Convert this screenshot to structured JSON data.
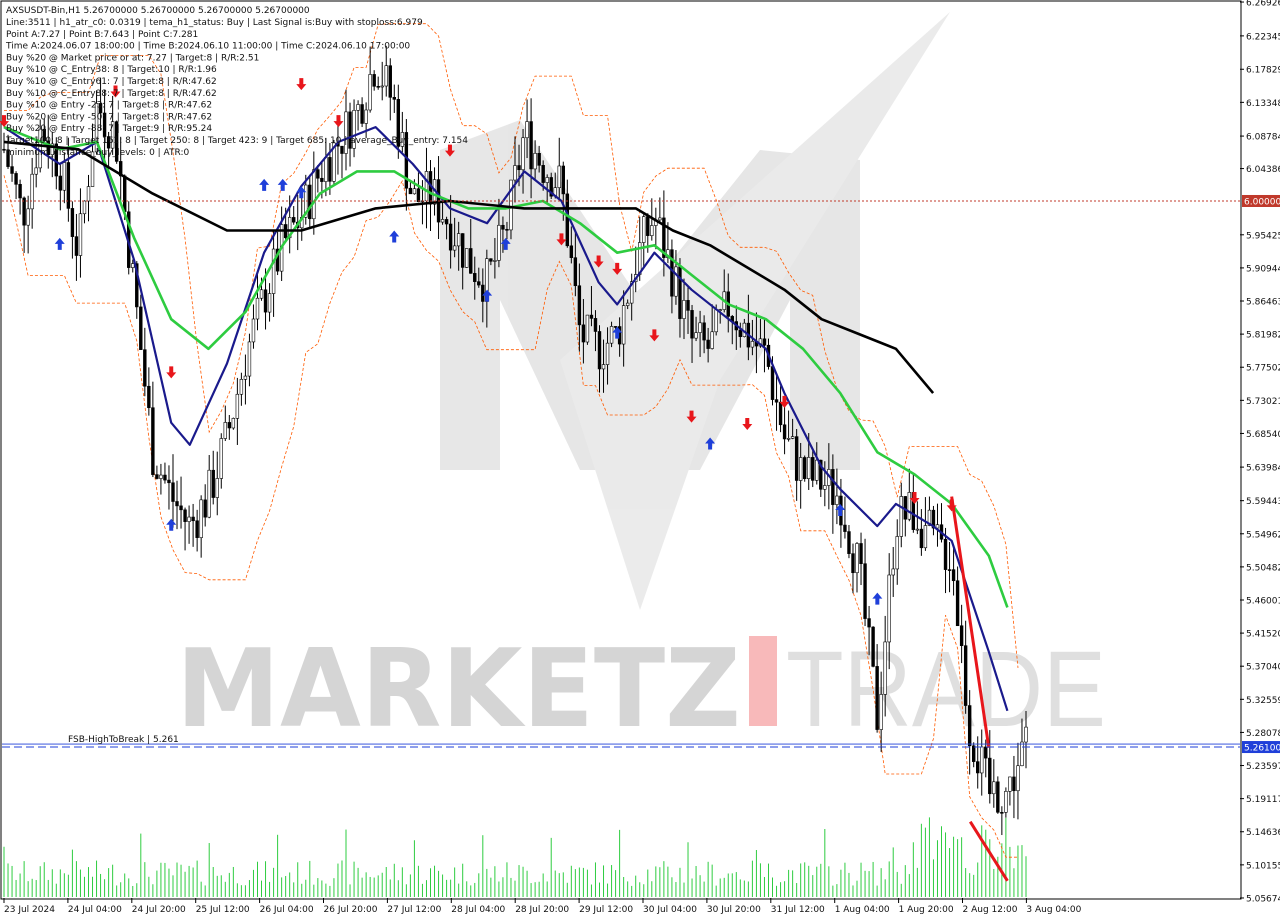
{
  "window": {
    "symbol_line": "AXSUSDT-Bin,H1  5.26700000 5.26700000 5.26700000 5.26700000"
  },
  "info_lines": [
    "Line:3511 | h1_atr_c0: 0.0319 | tema_h1_status: Buy | Last Signal is:Buy with stoploss:6.979",
    "Point A:7.27 | Point B:7.643 | Point C:7.281",
    "Time A:2024.06.07 18:00:00 | Time B:2024.06.10 11:00:00 | Time C:2024.06.10 17:00:00",
    "Buy %20 @ Market price or at: 7.27 | Target:8 | R/R:2.51",
    "Buy %10 @ C_Entry38: 8 | Target:10 | R/R:1.96",
    "Buy %10 @ C_Entry61: 7 | Target:8 | R/R:47.62",
    "Buy %10 @ C_Entry88: 7 | Target:8 | R/R:47.62",
    "Buy %10 @ Entry -23: 7 | Target:8 | R/R:47.62",
    "Buy %20 @ Entry -50: 7 | Target:8 | R/R:47.62",
    "Buy %20 @ Entry -88: 7 | Target:9 | R/R:95.24",
    "Target100: 8 | Target 161: 8 | Target 250: 8 | Target 423: 9 | Target 685: 10 | average_Buy_entry: 7.154",
    "minimum_distance_buy_levels: 0 | ATR:0"
  ],
  "watermark": {
    "brand_left": "MARKETZ",
    "brand_right": "TRADE"
  },
  "price_axis": {
    "ticks": [
      "6.26926",
      "6.22345",
      "6.17829",
      "6.13348",
      "6.08784",
      "6.04386",
      "6.00000",
      "5.95425",
      "5.90944",
      "5.86463",
      "5.81982",
      "5.77502",
      "5.73021",
      "5.68540",
      "5.63984",
      "5.59443",
      "5.54962",
      "5.50482",
      "5.46001",
      "5.41520",
      "5.37040",
      "5.32559",
      "5.28078",
      "5.26100",
      "5.23597",
      "5.19117",
      "5.14636",
      "5.10155",
      "5.05674"
    ],
    "highlighted": [
      {
        "label": "6.00000",
        "price": 6.0,
        "color": "#c0392b"
      },
      {
        "label": "5.26100",
        "price": 5.261,
        "color": "#1f3fd9"
      }
    ]
  },
  "time_axis": {
    "labels": [
      "23 Jul 2024",
      "24 Jul 04:00",
      "24 Jul 20:00",
      "25 Jul 12:00",
      "26 Jul 04:00",
      "26 Jul 20:00",
      "27 Jul 12:00",
      "28 Jul 04:00",
      "28 Jul 20:00",
      "29 Jul 12:00",
      "30 Jul 04:00",
      "30 Jul 20:00",
      "31 Jul 12:00",
      "1 Aug 04:00",
      "1 Aug 20:00",
      "2 Aug 12:00",
      "3 Aug 04:00"
    ]
  },
  "annotations": {
    "fsb_label": "FSB-HighToBreak | 5.261"
  },
  "colors": {
    "candle": "#000000",
    "volume": "#2ecc40",
    "tema_fast": "#1a1a8c",
    "ema_green": "#2ecc40",
    "sma_black": "#000000",
    "channel_orange": "#ff5a00",
    "buy_arrow": "#1f3fd9",
    "sell_arrow": "#e8161b",
    "trend_red": "#e8161b",
    "level_red": "#c0392b",
    "level_blue": "#1f3fd9"
  },
  "chart_data": {
    "type": "candlestick",
    "symbol": "AXSUSDT-Bin",
    "timeframe": "H1",
    "ylim": [
      5.0567,
      6.2693
    ],
    "x_labels": [
      "23 Jul 2024",
      "24 Jul 04:00",
      "24 Jul 20:00",
      "25 Jul 12:00",
      "26 Jul 04:00",
      "26 Jul 20:00",
      "27 Jul 12:00",
      "28 Jul 04:00",
      "28 Jul 20:00",
      "29 Jul 12:00",
      "30 Jul 04:00",
      "30 Jul 20:00",
      "31 Jul 12:00",
      "1 Aug 04:00",
      "1 Aug 20:00",
      "2 Aug 12:00",
      "3 Aug 04:00"
    ],
    "close_path": [
      [
        0,
        6.07
      ],
      [
        1,
        5.98
      ],
      [
        2,
        6.1
      ],
      [
        3,
        6.05
      ],
      [
        4,
        5.93
      ],
      [
        5,
        6.13
      ],
      [
        6,
        6.09
      ],
      [
        7,
        5.88
      ],
      [
        8,
        5.66
      ],
      [
        9,
        5.6
      ],
      [
        10,
        5.56
      ],
      [
        11,
        5.6
      ],
      [
        12,
        5.68
      ],
      [
        13,
        5.79
      ],
      [
        14,
        5.87
      ],
      [
        15,
        5.94
      ],
      [
        16,
        5.98
      ],
      [
        17,
        6.04
      ],
      [
        18,
        6.08
      ],
      [
        19,
        6.12
      ],
      [
        20,
        6.19
      ],
      [
        21,
        6.13
      ],
      [
        22,
        6.0
      ],
      [
        23,
        6.01
      ],
      [
        24,
        5.97
      ],
      [
        25,
        5.92
      ],
      [
        26,
        5.89
      ],
      [
        27,
        5.96
      ],
      [
        28,
        6.09
      ],
      [
        29,
        6.05
      ],
      [
        30,
        6.02
      ],
      [
        31,
        5.82
      ],
      [
        32,
        5.8
      ],
      [
        33,
        5.82
      ],
      [
        34,
        5.92
      ],
      [
        35,
        5.98
      ],
      [
        36,
        5.9
      ],
      [
        37,
        5.81
      ],
      [
        38,
        5.8
      ],
      [
        39,
        5.86
      ],
      [
        40,
        5.82
      ],
      [
        41,
        5.79
      ],
      [
        42,
        5.68
      ],
      [
        43,
        5.63
      ],
      [
        44,
        5.62
      ],
      [
        45,
        5.6
      ],
      [
        46,
        5.5
      ],
      [
        47,
        5.3
      ],
      [
        48,
        5.57
      ],
      [
        49,
        5.58
      ],
      [
        50,
        5.54
      ],
      [
        51,
        5.52
      ],
      [
        52,
        5.28
      ],
      [
        53,
        5.2
      ],
      [
        54,
        5.2
      ],
      [
        55,
        5.267
      ]
    ],
    "volume_range": [
      0,
      3.0
    ],
    "series": [
      {
        "name": "TEMA",
        "color": "#1a1a8c",
        "points": [
          [
            0,
            6.1
          ],
          [
            3,
            6.05
          ],
          [
            5,
            6.08
          ],
          [
            7,
            5.92
          ],
          [
            9,
            5.7
          ],
          [
            10,
            5.67
          ],
          [
            12,
            5.78
          ],
          [
            14,
            5.93
          ],
          [
            16,
            6.02
          ],
          [
            18,
            6.08
          ],
          [
            20,
            6.1
          ],
          [
            22,
            6.05
          ],
          [
            24,
            5.99
          ],
          [
            26,
            5.97
          ],
          [
            28,
            6.04
          ],
          [
            30,
            6.0
          ],
          [
            32,
            5.89
          ],
          [
            33,
            5.86
          ],
          [
            35,
            5.93
          ],
          [
            37,
            5.88
          ],
          [
            39,
            5.84
          ],
          [
            41,
            5.8
          ],
          [
            42,
            5.74
          ],
          [
            44,
            5.64
          ],
          [
            45,
            5.61
          ],
          [
            47,
            5.56
          ],
          [
            48,
            5.59
          ],
          [
            50,
            5.56
          ],
          [
            51,
            5.54
          ],
          [
            53,
            5.39
          ],
          [
            54,
            5.31
          ]
        ]
      },
      {
        "name": "EMA",
        "color": "#2ecc40",
        "points": [
          [
            0,
            6.1
          ],
          [
            3,
            6.07
          ],
          [
            5,
            6.08
          ],
          [
            7,
            5.95
          ],
          [
            9,
            5.84
          ],
          [
            11,
            5.8
          ],
          [
            13,
            5.85
          ],
          [
            15,
            5.94
          ],
          [
            17,
            6.01
          ],
          [
            19,
            6.04
          ],
          [
            21,
            6.04
          ],
          [
            23,
            6.01
          ],
          [
            25,
            5.99
          ],
          [
            27,
            5.99
          ],
          [
            29,
            6.0
          ],
          [
            31,
            5.97
          ],
          [
            33,
            5.93
          ],
          [
            35,
            5.94
          ],
          [
            37,
            5.9
          ],
          [
            39,
            5.86
          ],
          [
            41,
            5.84
          ],
          [
            43,
            5.8
          ],
          [
            45,
            5.74
          ],
          [
            47,
            5.66
          ],
          [
            49,
            5.63
          ],
          [
            51,
            5.59
          ],
          [
            53,
            5.52
          ],
          [
            54,
            5.45
          ]
        ]
      },
      {
        "name": "SMA",
        "color": "#000000",
        "points": [
          [
            0,
            6.08
          ],
          [
            4,
            6.07
          ],
          [
            8,
            6.01
          ],
          [
            12,
            5.96
          ],
          [
            16,
            5.96
          ],
          [
            20,
            5.99
          ],
          [
            24,
            6.0
          ],
          [
            28,
            5.99
          ],
          [
            32,
            5.99
          ],
          [
            34,
            5.99
          ],
          [
            36,
            5.96
          ],
          [
            38,
            5.94
          ],
          [
            40,
            5.91
          ],
          [
            42,
            5.88
          ],
          [
            44,
            5.84
          ],
          [
            46,
            5.82
          ],
          [
            48,
            5.8
          ],
          [
            50,
            5.74
          ]
        ]
      }
    ],
    "buy_arrows": [
      [
        3,
        5.95
      ],
      [
        9,
        5.57
      ],
      [
        14,
        6.03
      ],
      [
        15,
        6.03
      ],
      [
        16,
        6.02
      ],
      [
        21,
        5.96
      ],
      [
        26,
        5.88
      ],
      [
        27,
        5.95
      ],
      [
        33,
        5.83
      ],
      [
        38,
        5.68
      ],
      [
        45,
        5.59
      ],
      [
        47,
        5.47
      ]
    ],
    "sell_arrows": [
      [
        0,
        6.1
      ],
      [
        6,
        6.14
      ],
      [
        9,
        5.76
      ],
      [
        16,
        6.15
      ],
      [
        18,
        6.1
      ],
      [
        24,
        6.06
      ],
      [
        30,
        5.94
      ],
      [
        32,
        5.91
      ],
      [
        33,
        5.9
      ],
      [
        35,
        5.81
      ],
      [
        37,
        5.7
      ],
      [
        40,
        5.69
      ],
      [
        42,
        5.72
      ],
      [
        49,
        5.59
      ],
      [
        51,
        5.58
      ]
    ],
    "trend_line": [
      [
        51,
        5.6
      ],
      [
        53,
        5.26
      ]
    ],
    "trend_line_2": [
      [
        52,
        5.16
      ],
      [
        54,
        5.08
      ]
    ],
    "levels": [
      {
        "name": "FSB-HighToBreak",
        "value": 5.261
      },
      {
        "value": 6.0
      }
    ]
  }
}
